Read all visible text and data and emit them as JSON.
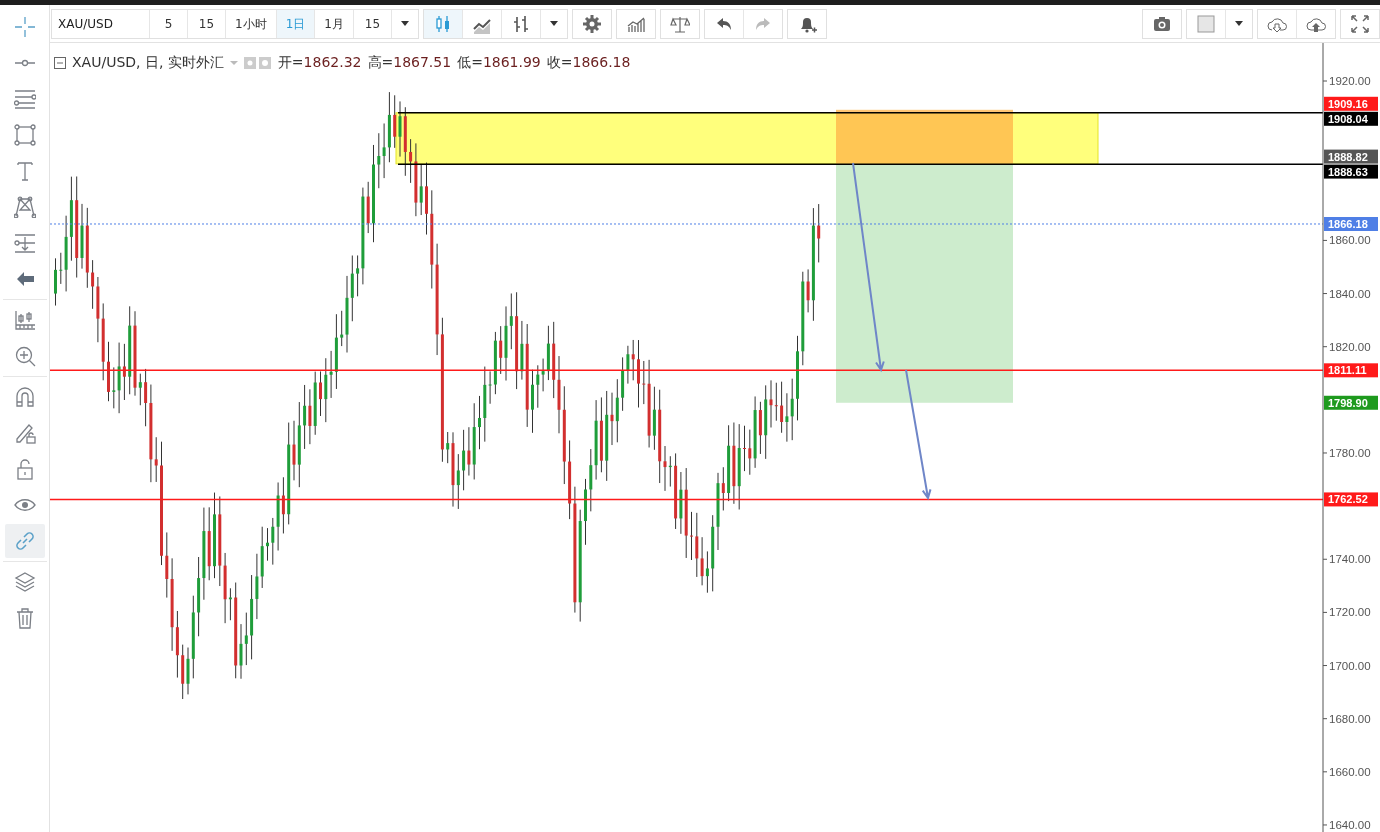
{
  "sidebar": {
    "groups": [
      [
        {
          "kind": "crosshair",
          "selected": false
        },
        {
          "kind": "horizontal-line",
          "selected": false
        },
        {
          "kind": "parallel-lines",
          "selected": false
        },
        {
          "kind": "rectangle",
          "selected": false
        },
        {
          "kind": "text",
          "selected": false
        },
        {
          "kind": "pattern",
          "selected": false
        },
        {
          "kind": "measure",
          "selected": false
        },
        {
          "kind": "back",
          "selected": false
        }
      ],
      [
        {
          "kind": "ruler",
          "selected": false
        },
        {
          "kind": "zoom",
          "selected": false
        }
      ],
      [
        {
          "kind": "magnet",
          "selected": false
        },
        {
          "kind": "pencil-lock",
          "selected": false
        },
        {
          "kind": "unlock",
          "selected": false
        },
        {
          "kind": "eye",
          "selected": false
        },
        {
          "kind": "link",
          "selected": true
        }
      ],
      [
        {
          "kind": "layers",
          "selected": false
        },
        {
          "kind": "trash",
          "selected": false
        }
      ]
    ]
  },
  "toolbar": {
    "symbol": "XAU/USD",
    "intervals": [
      {
        "label": "5",
        "selected": false
      },
      {
        "label": "15",
        "selected": false
      },
      {
        "label": "1小时",
        "selected": false
      },
      {
        "label": "1日",
        "selected": true
      },
      {
        "label": "1月",
        "selected": false
      },
      {
        "label": "15",
        "selected": false
      }
    ],
    "chart_types": [
      {
        "kind": "candles",
        "selected": true
      },
      {
        "kind": "line",
        "selected": false
      },
      {
        "kind": "bars",
        "selected": false
      }
    ],
    "history": [
      {
        "kind": "undo",
        "disabled": false
      },
      {
        "kind": "redo",
        "disabled": true
      }
    ]
  },
  "legend": {
    "title": "XAU/USD, 日, 实时外汇",
    "values": [
      {
        "label": "开=",
        "value": "1862.32"
      },
      {
        "label": "高=",
        "value": "1867.51"
      },
      {
        "label": "低=",
        "value": "1861.99"
      },
      {
        "label": "收=",
        "value": "1866.18"
      }
    ]
  },
  "price_axis": {
    "ticks": [
      "1920.00",
      "1860.00",
      "1840.00",
      "1820.00",
      "1780.00",
      "1740.00",
      "1720.00",
      "1700.00",
      "1680.00",
      "1660.00",
      "1640.00"
    ],
    "tags": [
      {
        "label": "1909.16",
        "color": "#ff1a1a"
      },
      {
        "label": "1908.04",
        "color": "#000000"
      },
      {
        "label": "1888.82",
        "color": "#555555"
      },
      {
        "label": "1888.63",
        "color": "#000000"
      },
      {
        "label": "1866.18",
        "color": "#4f7fe6"
      },
      {
        "label": "1811.11",
        "color": "#ff1a1a"
      },
      {
        "label": "1798.90",
        "color": "#1e9a1e"
      },
      {
        "label": "1762.52",
        "color": "#ff1a1a"
      }
    ]
  }
}
